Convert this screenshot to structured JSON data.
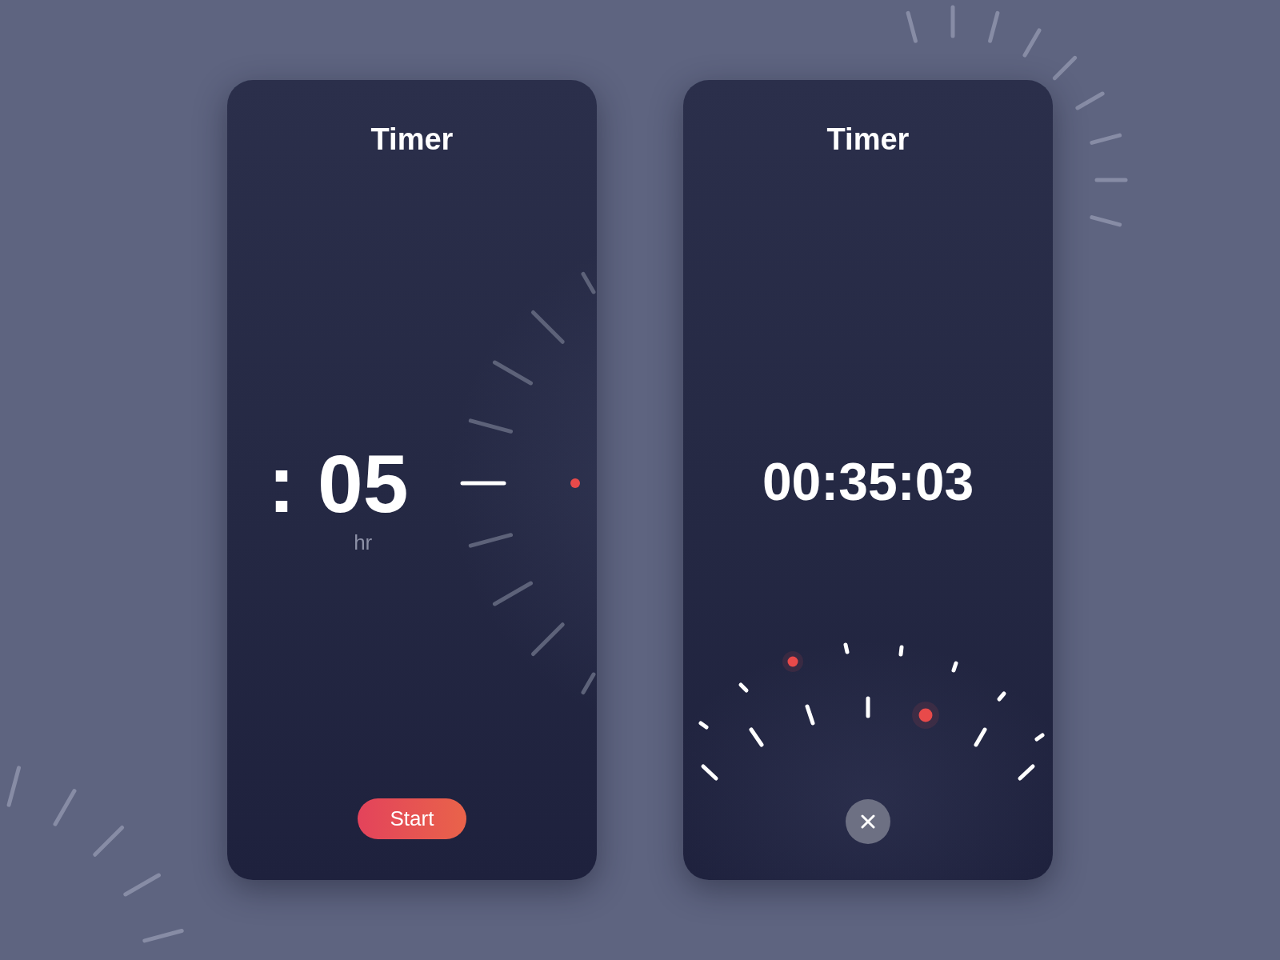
{
  "screens": [
    {
      "kind": "picker",
      "title": "Timer",
      "picker": {
        "separator": ":",
        "value": "05",
        "unit": "hr"
      },
      "dial": {
        "ticks": [
          {
            "selected": false
          },
          {
            "selected": false
          },
          {
            "selected": false
          },
          {
            "selected": false
          },
          {
            "selected": true
          },
          {
            "selected": false
          },
          {
            "selected": false
          },
          {
            "selected": false
          },
          {
            "selected": false
          }
        ]
      },
      "button": {
        "kind": "text",
        "label": "Start"
      }
    },
    {
      "kind": "countdown",
      "title": "Timer",
      "time": "00:35:03",
      "button": {
        "kind": "close"
      }
    }
  ]
}
